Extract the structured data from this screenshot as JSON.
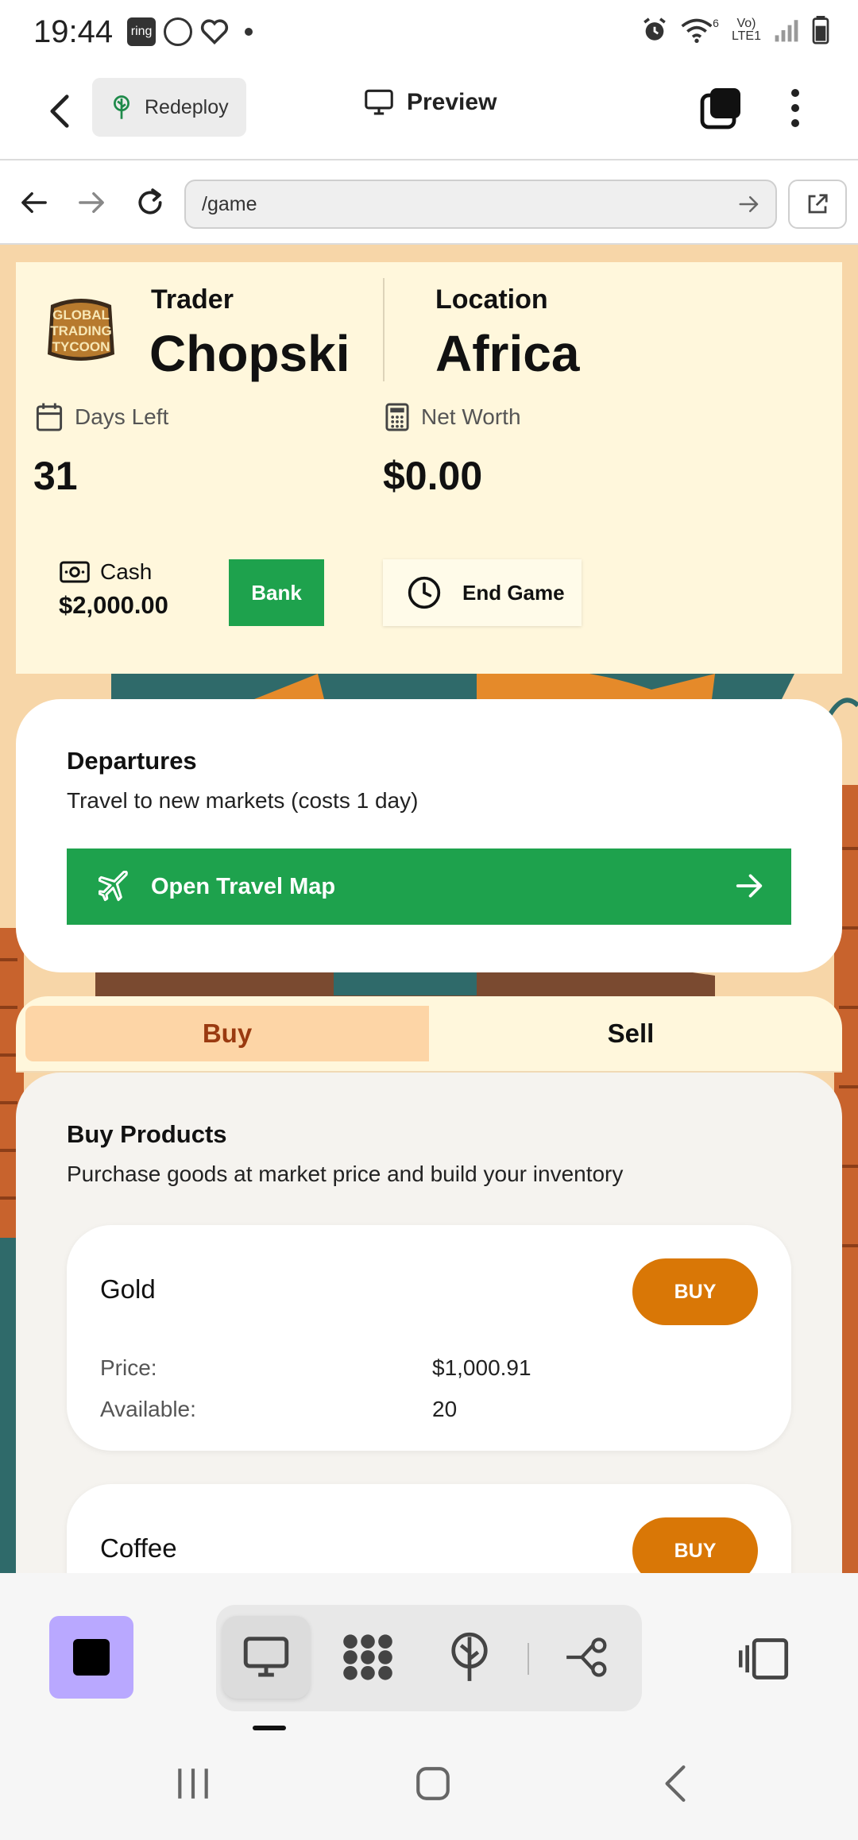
{
  "status_bar": {
    "time": "19:44",
    "left_icons": [
      "ring-icon",
      "lens-icon",
      "heart-icon",
      "dot"
    ],
    "ring_label": "ring",
    "network_label_top": "Vo)",
    "network_label_bottom": "LTE1",
    "wifi_label": "6"
  },
  "app_header": {
    "redeploy_label": "Redeploy",
    "preview_label": "Preview"
  },
  "url_bar": {
    "path": "/game"
  },
  "game": {
    "logo_text": [
      "GLOBAL",
      "TRADING",
      "TYCOON"
    ],
    "trader_label": "Trader",
    "trader_name": "Chopski",
    "location_label": "Location",
    "location_name": "Africa",
    "days_left_label": "Days Left",
    "days_left_value": "31",
    "net_worth_label": "Net Worth",
    "net_worth_value": "$0.00",
    "cash_label": "Cash",
    "cash_value": "$2,000.00",
    "bank_label": "Bank",
    "end_game_label": "End Game",
    "departures": {
      "title": "Departures",
      "subtitle": "Travel to new markets (costs 1 day)",
      "button_label": "Open Travel Map"
    },
    "tabs": {
      "buy": "Buy",
      "sell": "Sell",
      "active": "Buy"
    },
    "buy_panel": {
      "title": "Buy Products",
      "subtitle": "Purchase goods at market price and build your inventory",
      "price_label": "Price:",
      "available_label": "Available:",
      "buy_button_label": "BUY",
      "products": [
        {
          "name": "Gold",
          "price": "$1,000.91",
          "available": "20"
        },
        {
          "name": "Coffee"
        }
      ]
    }
  },
  "colors": {
    "green": "#1ea24d",
    "orange": "#d97706",
    "card_bg": "#fff7dc",
    "buy_tab_bg": "#fdd5a6",
    "buy_tab_text": "#9a3a10",
    "stop_btn_bg": "#b9a8ff"
  },
  "bottom_toolbar": {
    "icons": [
      "stop-icon",
      "monitor-icon",
      "dots-grid-icon",
      "deploy-icon",
      "flow-icon",
      "layout-icon"
    ],
    "active": "monitor-icon"
  },
  "nav_bar": {
    "icons": [
      "recents-icon",
      "home-icon",
      "back-icon"
    ]
  }
}
